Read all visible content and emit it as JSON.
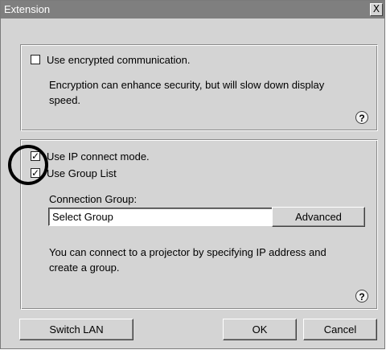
{
  "window": {
    "title": "Extension",
    "close_glyph": "X",
    "close_icon": "close-icon"
  },
  "encryption": {
    "checkbox_label": "Use encrypted communication.",
    "checked": false,
    "description_line1": "Encryption can enhance security, but will slow down display",
    "description_line2": "speed.",
    "help_glyph": "?"
  },
  "connection": {
    "ip_mode_label": "Use IP connect mode.",
    "ip_mode_checked": true,
    "group_list_label": "Use Group List",
    "group_list_checked": true,
    "group_field_label": "Connection Group:",
    "group_select_value": "Select Group",
    "advanced_label": "Advanced",
    "description_line1": "You can connect to a projector by specifying IP address and",
    "description_line2": "create a group.",
    "help_glyph": "?"
  },
  "buttons": {
    "switch_lan": "Switch LAN",
    "ok": "OK",
    "cancel": "Cancel"
  },
  "glyphs": {
    "check": "✓",
    "dropdown_arrow": "▼"
  },
  "icons": {
    "help": "help-icon",
    "dropdown": "dropdown-arrow-icon"
  }
}
